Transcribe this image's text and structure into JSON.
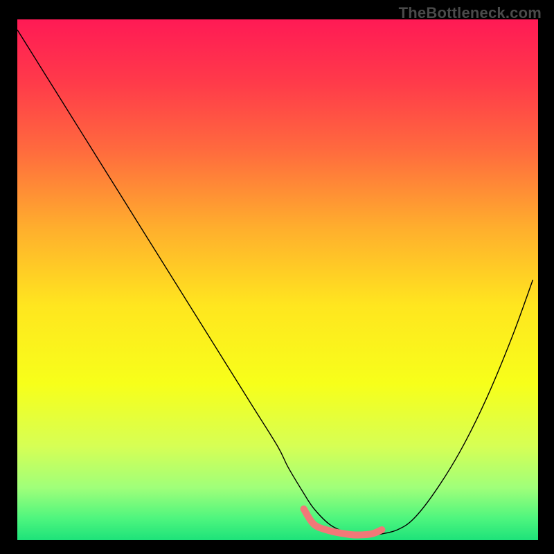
{
  "watermark": "TheBottleneck.com",
  "chart_data": {
    "type": "line",
    "title": "",
    "xlabel": "",
    "ylabel": "",
    "xlim": [
      0,
      100
    ],
    "ylim": [
      0,
      100
    ],
    "grid": false,
    "background_gradient": {
      "stops": [
        {
          "offset": 0.0,
          "color": "#ff1a55"
        },
        {
          "offset": 0.12,
          "color": "#ff3a4a"
        },
        {
          "offset": 0.25,
          "color": "#ff6a3e"
        },
        {
          "offset": 0.4,
          "color": "#ffae2d"
        },
        {
          "offset": 0.55,
          "color": "#ffe61f"
        },
        {
          "offset": 0.7,
          "color": "#f7ff1a"
        },
        {
          "offset": 0.82,
          "color": "#d6ff55"
        },
        {
          "offset": 0.9,
          "color": "#9fff7a"
        },
        {
          "offset": 0.96,
          "color": "#4cf57e"
        },
        {
          "offset": 1.0,
          "color": "#1de27a"
        }
      ]
    },
    "series": [
      {
        "name": "curve",
        "color": "#000000",
        "stroke_width": 1.4,
        "x": [
          0,
          5,
          10,
          15,
          20,
          25,
          30,
          35,
          40,
          45,
          50,
          52,
          55,
          57,
          60,
          63,
          65,
          68,
          70,
          73,
          76,
          80,
          85,
          90,
          95,
          99
        ],
        "y": [
          98,
          90,
          82,
          74,
          66,
          58,
          50,
          42,
          34,
          26,
          18,
          14,
          9,
          6,
          3,
          1.5,
          1,
          1,
          1.2,
          2,
          4,
          9,
          17,
          27,
          39,
          50
        ]
      },
      {
        "name": "bottom-marker",
        "color": "#f17878",
        "stroke_width": 10,
        "linecap": "round",
        "x": [
          55,
          57,
          60,
          63,
          65,
          68,
          70
        ],
        "y": [
          6,
          3,
          1.8,
          1.2,
          1,
          1.2,
          2
        ]
      }
    ]
  }
}
